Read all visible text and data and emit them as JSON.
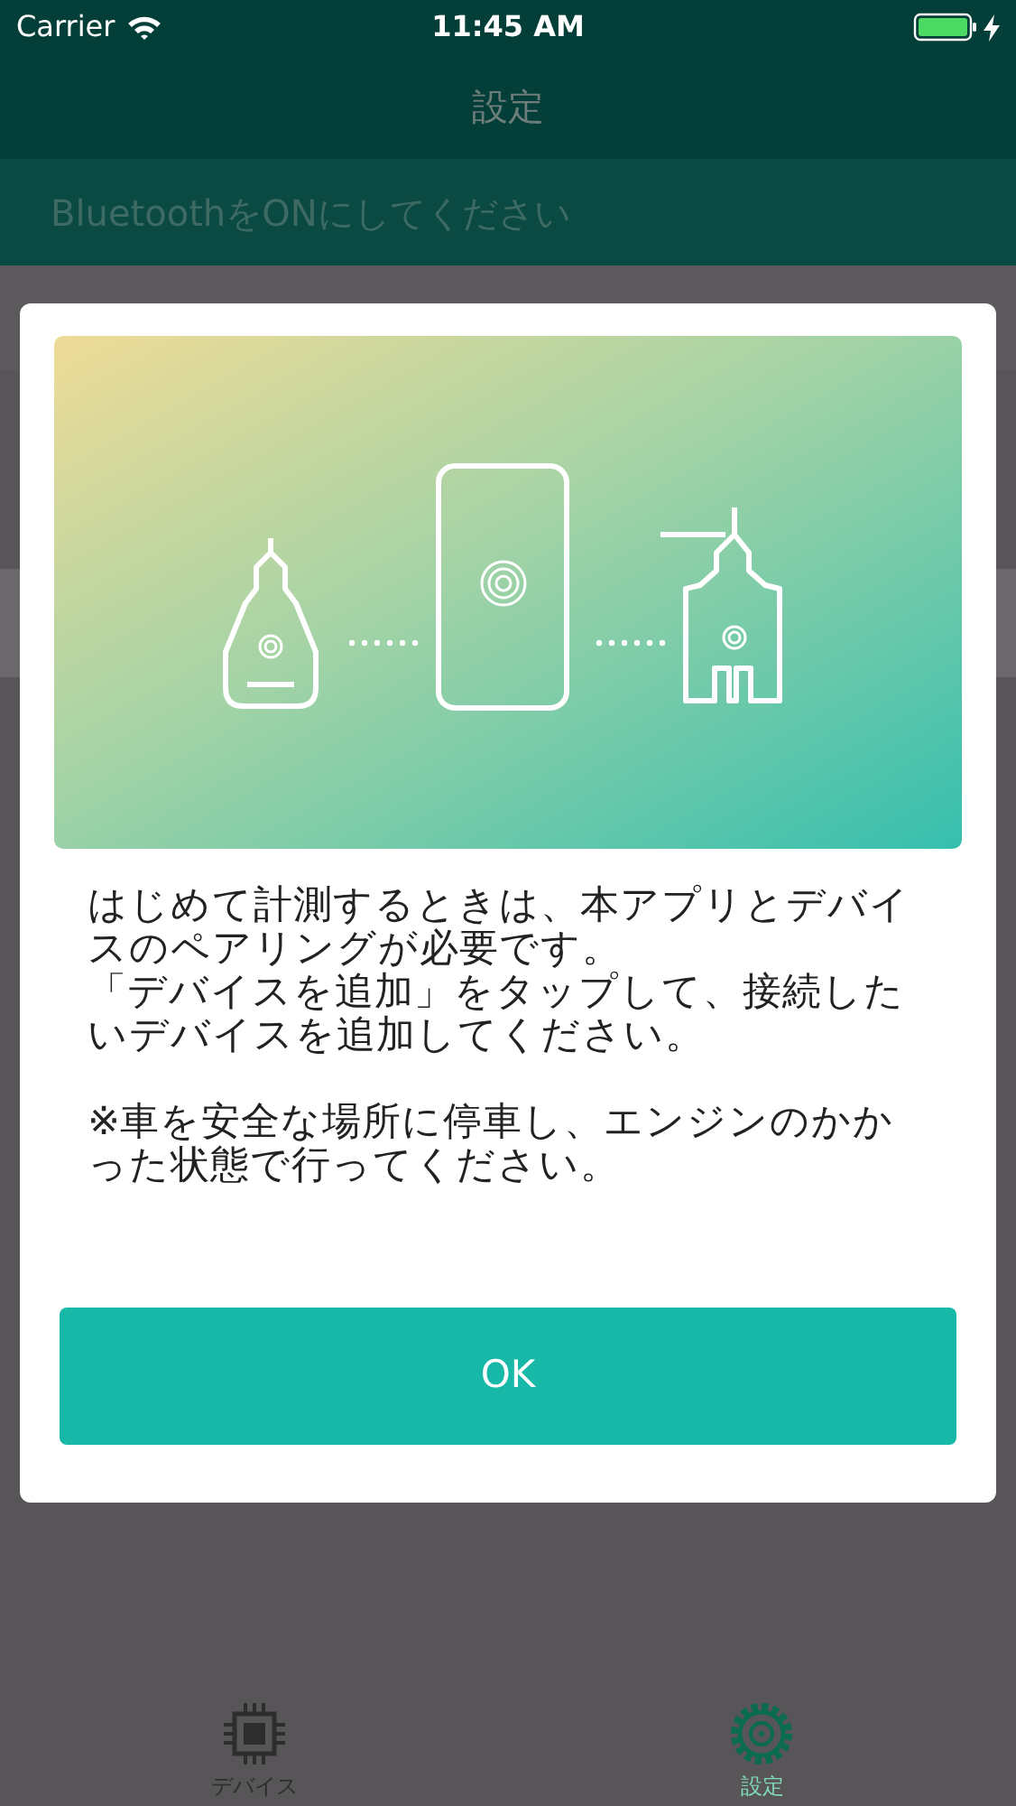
{
  "status_bar": {
    "carrier": "Carrier",
    "time": "11:45 AM"
  },
  "nav": {
    "title": "設定"
  },
  "banner": {
    "text": "BluetoothをONにしてください"
  },
  "dialog": {
    "paragraphs": [
      {
        "kind": "body",
        "text": "はじめて計測するときは、本アプリとデバイスのペアリングが必要です。"
      },
      {
        "kind": "body",
        "text": "「デバイスを追加」をタップして、接続したいデバイスを追加してください。"
      },
      {
        "kind": "note",
        "text": "※車を安全な場所に停車し、エンジンのかかった状態で行ってください。"
      }
    ],
    "button": "OK"
  },
  "tabs": [
    {
      "label": "デバイス",
      "kind": "chip",
      "selected": false
    },
    {
      "label": "設定",
      "kind": "gear",
      "selected": true
    }
  ]
}
